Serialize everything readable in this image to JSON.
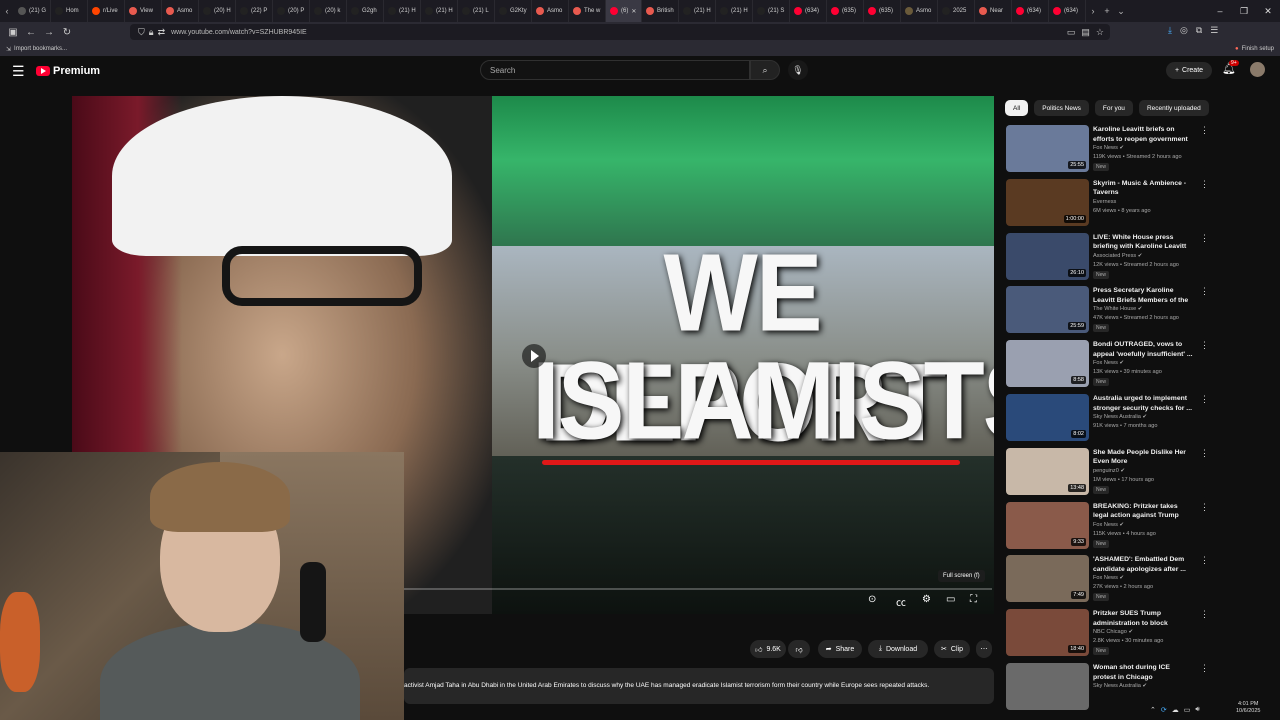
{
  "browser": {
    "tabs": [
      {
        "label": "(21) G",
        "color": "#555"
      },
      {
        "label": "Hom",
        "color": "#222"
      },
      {
        "label": "r/Live",
        "color": "#ff4500"
      },
      {
        "label": "View",
        "color": "#e85a4f"
      },
      {
        "label": "Asmo",
        "color": "#e85a4f"
      },
      {
        "label": "(20) H",
        "color": "#222"
      },
      {
        "label": "(22) P",
        "color": "#222"
      },
      {
        "label": "(20) P",
        "color": "#222"
      },
      {
        "label": "(20) k",
        "color": "#222"
      },
      {
        "label": "G2gh",
        "color": "#222"
      },
      {
        "label": "(21) H",
        "color": "#222"
      },
      {
        "label": "(21) H",
        "color": "#222"
      },
      {
        "label": "(21) L",
        "color": "#222"
      },
      {
        "label": "G2Kty",
        "color": "#222"
      },
      {
        "label": "Asmo",
        "color": "#e85a4f"
      },
      {
        "label": "The w",
        "color": "#e85a4f"
      },
      {
        "label": "(6)",
        "color": "#ff0033"
      },
      {
        "label": "British",
        "color": "#e85a4f"
      },
      {
        "label": "(21) H",
        "color": "#222"
      },
      {
        "label": "(21) H",
        "color": "#222"
      },
      {
        "label": "(21) S",
        "color": "#222"
      },
      {
        "label": "(634)",
        "color": "#ff0033"
      },
      {
        "label": "(635)",
        "color": "#ff0033"
      },
      {
        "label": "(635)",
        "color": "#ff0033"
      },
      {
        "label": "Asmo",
        "color": "#6a5a3a"
      },
      {
        "label": "2025",
        "color": "#222"
      },
      {
        "label": "Near",
        "color": "#e85a4f"
      },
      {
        "label": "(634)",
        "color": "#ff0033"
      },
      {
        "label": "(634)",
        "color": "#ff0033"
      }
    ],
    "url": "www.youtube.com/watch?v=SZHUBR945IE",
    "bookmarks_label": "Import bookmarks...",
    "finish_setup": "Finish setup"
  },
  "youtube": {
    "logo_text": "Premium",
    "search_placeholder": "Search",
    "create_label": "Create",
    "notif_count": "9+"
  },
  "video": {
    "thumb_line1": "WE DEPORT",
    "thumb_line2": "ISLAMISTS",
    "fullscreen_tip": "Full screen (f)",
    "likes": "9.6K",
    "share_label": "Share",
    "download_label": "Download",
    "clip_label": "Clip",
    "description": "activist Amjad Taha in Abu Dhabi in the United Arab Emirates to discuss why the UAE has managed eradicate Islamist terrorism form their country while Europe sees repeated attacks."
  },
  "chips": [
    "All",
    "Politics News",
    "For you",
    "Recently uploaded"
  ],
  "recommendations": [
    {
      "title": "Karoline Leavitt briefs on efforts to reopen government ...",
      "channel": "Fox News ✔",
      "meta": "119K views • Streamed 2 hours ago",
      "badge": "New",
      "duration": "25:55",
      "thumb": "#6a7a9a"
    },
    {
      "title": "Skyrim - Music & Ambience - Taverns",
      "channel": "Everness",
      "meta": "6M views • 8 years ago",
      "badge": "",
      "duration": "1:00:00",
      "thumb": "#5a3a22"
    },
    {
      "title": "LIVE: White House press briefing with Karoline Leavitt",
      "channel": "Associated Press ✔",
      "meta": "12K views • Streamed 2 hours ago",
      "badge": "New",
      "duration": "26:10",
      "thumb": "#3a4a6a"
    },
    {
      "title": "Press Secretary Karoline Leavitt Briefs Members of the Media, ...",
      "channel": "The White House ✔",
      "meta": "47K views • Streamed 2 hours ago",
      "badge": "New",
      "duration": "25:59",
      "thumb": "#4a5a7a"
    },
    {
      "title": "Bondi OUTRAGED, vows to appeal 'woefully insufficient' ...",
      "channel": "Fox News ✔",
      "meta": "13K views • 39 minutes ago",
      "badge": "New",
      "duration": "8:58",
      "thumb": "#9aa0b0"
    },
    {
      "title": "Australia urged to implement stronger security checks for ...",
      "channel": "Sky News Australia ✔",
      "meta": "91K views • 7 months ago",
      "badge": "",
      "duration": "8:02",
      "thumb": "#2a4a7a"
    },
    {
      "title": "She Made People Dislike Her Even More",
      "channel": "penguinz0 ✔",
      "meta": "1M views • 17 hours ago",
      "badge": "New",
      "duration": "13:48",
      "thumb": "#c8b8a8"
    },
    {
      "title": "BREAKING: Pritzker takes legal action against Trump admin ...",
      "channel": "Fox News ✔",
      "meta": "115K views • 4 hours ago",
      "badge": "New",
      "duration": "9:33",
      "thumb": "#8a5a4a"
    },
    {
      "title": "'ASHAMED': Embattled Dem candidate apologizes after ...",
      "channel": "Fox News ✔",
      "meta": "27K views • 2 hours ago",
      "badge": "New",
      "duration": "7:49",
      "thumb": "#7a6a5a"
    },
    {
      "title": "Pritzker SUES Trump administration to block Nation...",
      "channel": "NBC Chicago ✔",
      "meta": "2.8K views • 30 minutes ago",
      "badge": "New",
      "duration": "18:40",
      "thumb": "#7a4a3a"
    },
    {
      "title": "Woman shot during ICE protest in Chicago",
      "channel": "Sky News Australia ✔",
      "meta": "",
      "badge": "",
      "duration": "",
      "thumb": "#6a6a6a"
    }
  ],
  "system": {
    "time": "4:01 PM",
    "date": "10/6/2025"
  }
}
